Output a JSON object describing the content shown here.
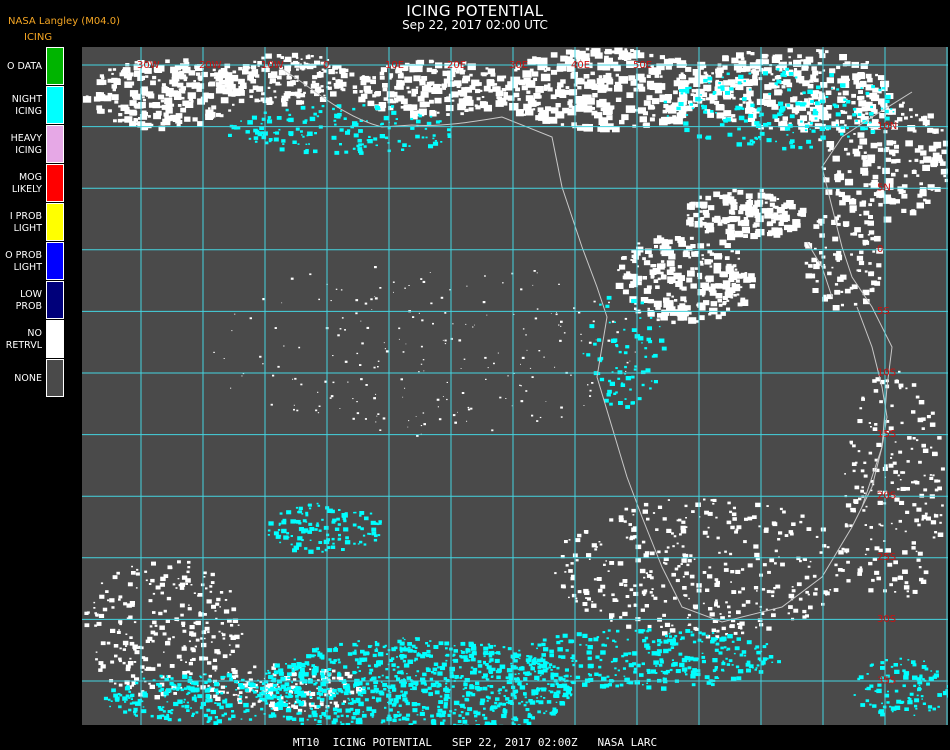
{
  "header": {
    "title": "ICING POTENTIAL",
    "subtitle": "Sep 22, 2017 02:00 UTC",
    "org_label": "NASA Langley (M04.0)"
  },
  "legend": {
    "title": "ICING",
    "items": [
      {
        "label": "O DATA",
        "color": "#00b400"
      },
      {
        "label": "NIGHT\nICING",
        "color": "#00ffff"
      },
      {
        "label": "HEAVY\nICING",
        "color": "#e6a8e6"
      },
      {
        "label": "MOG\nLIKELY",
        "color": "#ff0000"
      },
      {
        "label": "I PROB\nLIGHT",
        "color": "#ffff00"
      },
      {
        "label": "O PROB\nLIGHT",
        "color": "#0000ff"
      },
      {
        "label": "LOW\nPROB",
        "color": "#00007a"
      },
      {
        "label": "NO\nRETRVL",
        "color": "#ffffff"
      },
      {
        "label": "NONE",
        "color": "#4a4a4a"
      }
    ]
  },
  "map": {
    "grid_color": "#44d4e0",
    "label_color": "#cc1111",
    "longitude_labels": [
      "30W",
      "20W",
      "10W",
      "0",
      "10E",
      "20E",
      "30E",
      "40E",
      "50E"
    ],
    "latitude_labels": [
      "10N",
      "5N",
      "0",
      "5S",
      "10S",
      "15S",
      "20S",
      "25S",
      "30S",
      "35S"
    ]
  },
  "footer": {
    "text": "MT10  ICING POTENTIAL   SEP 22, 2017 02:00Z   NASA LARC"
  }
}
